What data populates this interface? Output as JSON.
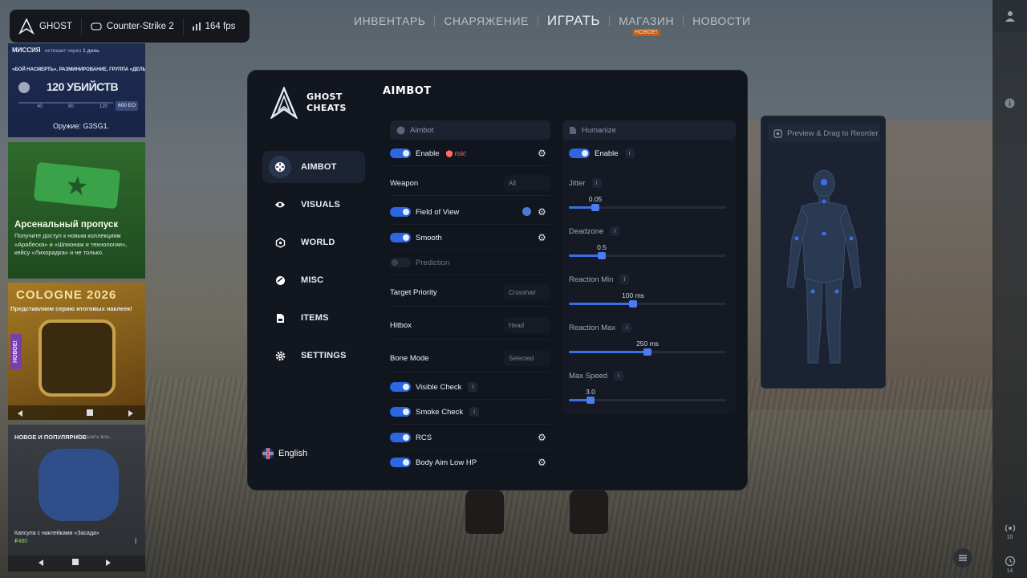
{
  "topbar": {
    "user": "GHOST",
    "game": "Counter-Strike 2",
    "fps": "164 fps"
  },
  "nav": {
    "items": [
      "ИНВЕНТАРЬ",
      "СНАРЯЖЕНИЕ",
      "ИГРАТЬ",
      "МАГАЗИН",
      "НОВОСТИ"
    ],
    "badge": "НОВОЕ!"
  },
  "right_rail": {
    "signal_count": "10",
    "history_count": "14"
  },
  "cards": {
    "mission": {
      "title": "МИССИЯ",
      "expires": "истекает через",
      "expires_value": "1 день",
      "description": "«БОЙ НАСМЕРТЬ», РАЗМИНИРОВАНИЕ, ГРУППА «ДЕЛЬТА»",
      "goal": "120 УБИЙСТВ",
      "marks": [
        "40",
        "80",
        "120"
      ],
      "reward": "600 ЕО",
      "weapon": "Оружие: G3SG1."
    },
    "pass": {
      "title": "Арсенальный пропуск",
      "text": "Получите доступ к новым коллекциям «Арабеска» и «Шпионаж и технологии», кейсу «Лихорадка» и не только."
    },
    "cologne": {
      "title": "COLOGNE 2026",
      "subtitle": "Представляем серию итоговых наклеек!",
      "tag": "НОВОЕ!"
    },
    "new_popular": {
      "title": "НОВОЕ И ПОПУЛЯРНОЕ",
      "link": "Показать все...",
      "item": "Капсула с наклейками «Засада»",
      "price": "₽480"
    }
  },
  "panel": {
    "brand": {
      "line1": "GHOST",
      "line2": "CHEATS"
    },
    "menu": [
      {
        "label": "AIMBOT",
        "icon": "crosshair-icon",
        "active": true
      },
      {
        "label": "VISUALS",
        "icon": "eye-icon",
        "active": false
      },
      {
        "label": "WORLD",
        "icon": "globe-icon",
        "active": false
      },
      {
        "label": "MISC",
        "icon": "misc-icon",
        "active": false
      },
      {
        "label": "ITEMS",
        "icon": "file-icon",
        "active": false
      },
      {
        "label": "SETTINGS",
        "icon": "gear-icon",
        "active": false
      }
    ],
    "language": "English",
    "section_title": "AIMBOT",
    "aimbot": {
      "header": "Aimbot",
      "enable": "Enable",
      "risk": "risk!",
      "weapon_label": "Weapon",
      "weapon_value": "All",
      "fov": "Field of View",
      "smooth": "Smooth",
      "prediction": "Prediction",
      "target_priority_label": "Target Priority",
      "target_priority_value": "Crosshair",
      "hitbox_label": "Hitbox",
      "hitbox_value": "Head",
      "bone_mode_label": "Bone Mode",
      "bone_mode_value": "Selected",
      "visible_check": "Visible Check",
      "smoke_check": "Smoke Check",
      "rcs": "RCS",
      "body_aim": "Body Aim Low HP"
    },
    "humanize": {
      "header": "Humanize",
      "enable": "Enable",
      "sliders": [
        {
          "label": "Jitter",
          "value": "0.05",
          "level": 0.17
        },
        {
          "label": "Deadzone",
          "value": "0.5",
          "level": 0.21
        },
        {
          "label": "Reaction Min",
          "value": "100 ms",
          "level": 0.41
        },
        {
          "label": "Reaction Max",
          "value": "250 ms",
          "level": 0.5
        },
        {
          "label": "Max Speed",
          "value": "3.0",
          "level": 0.14
        }
      ]
    },
    "preview": {
      "header": "Preview & Drag to Reorder"
    }
  },
  "info_glyph": "i",
  "colors": {
    "accent": "#3d6fe0",
    "panel_bg": "#11151d",
    "risk": "#ff6b5c",
    "nav_badge": "#c65c12"
  }
}
